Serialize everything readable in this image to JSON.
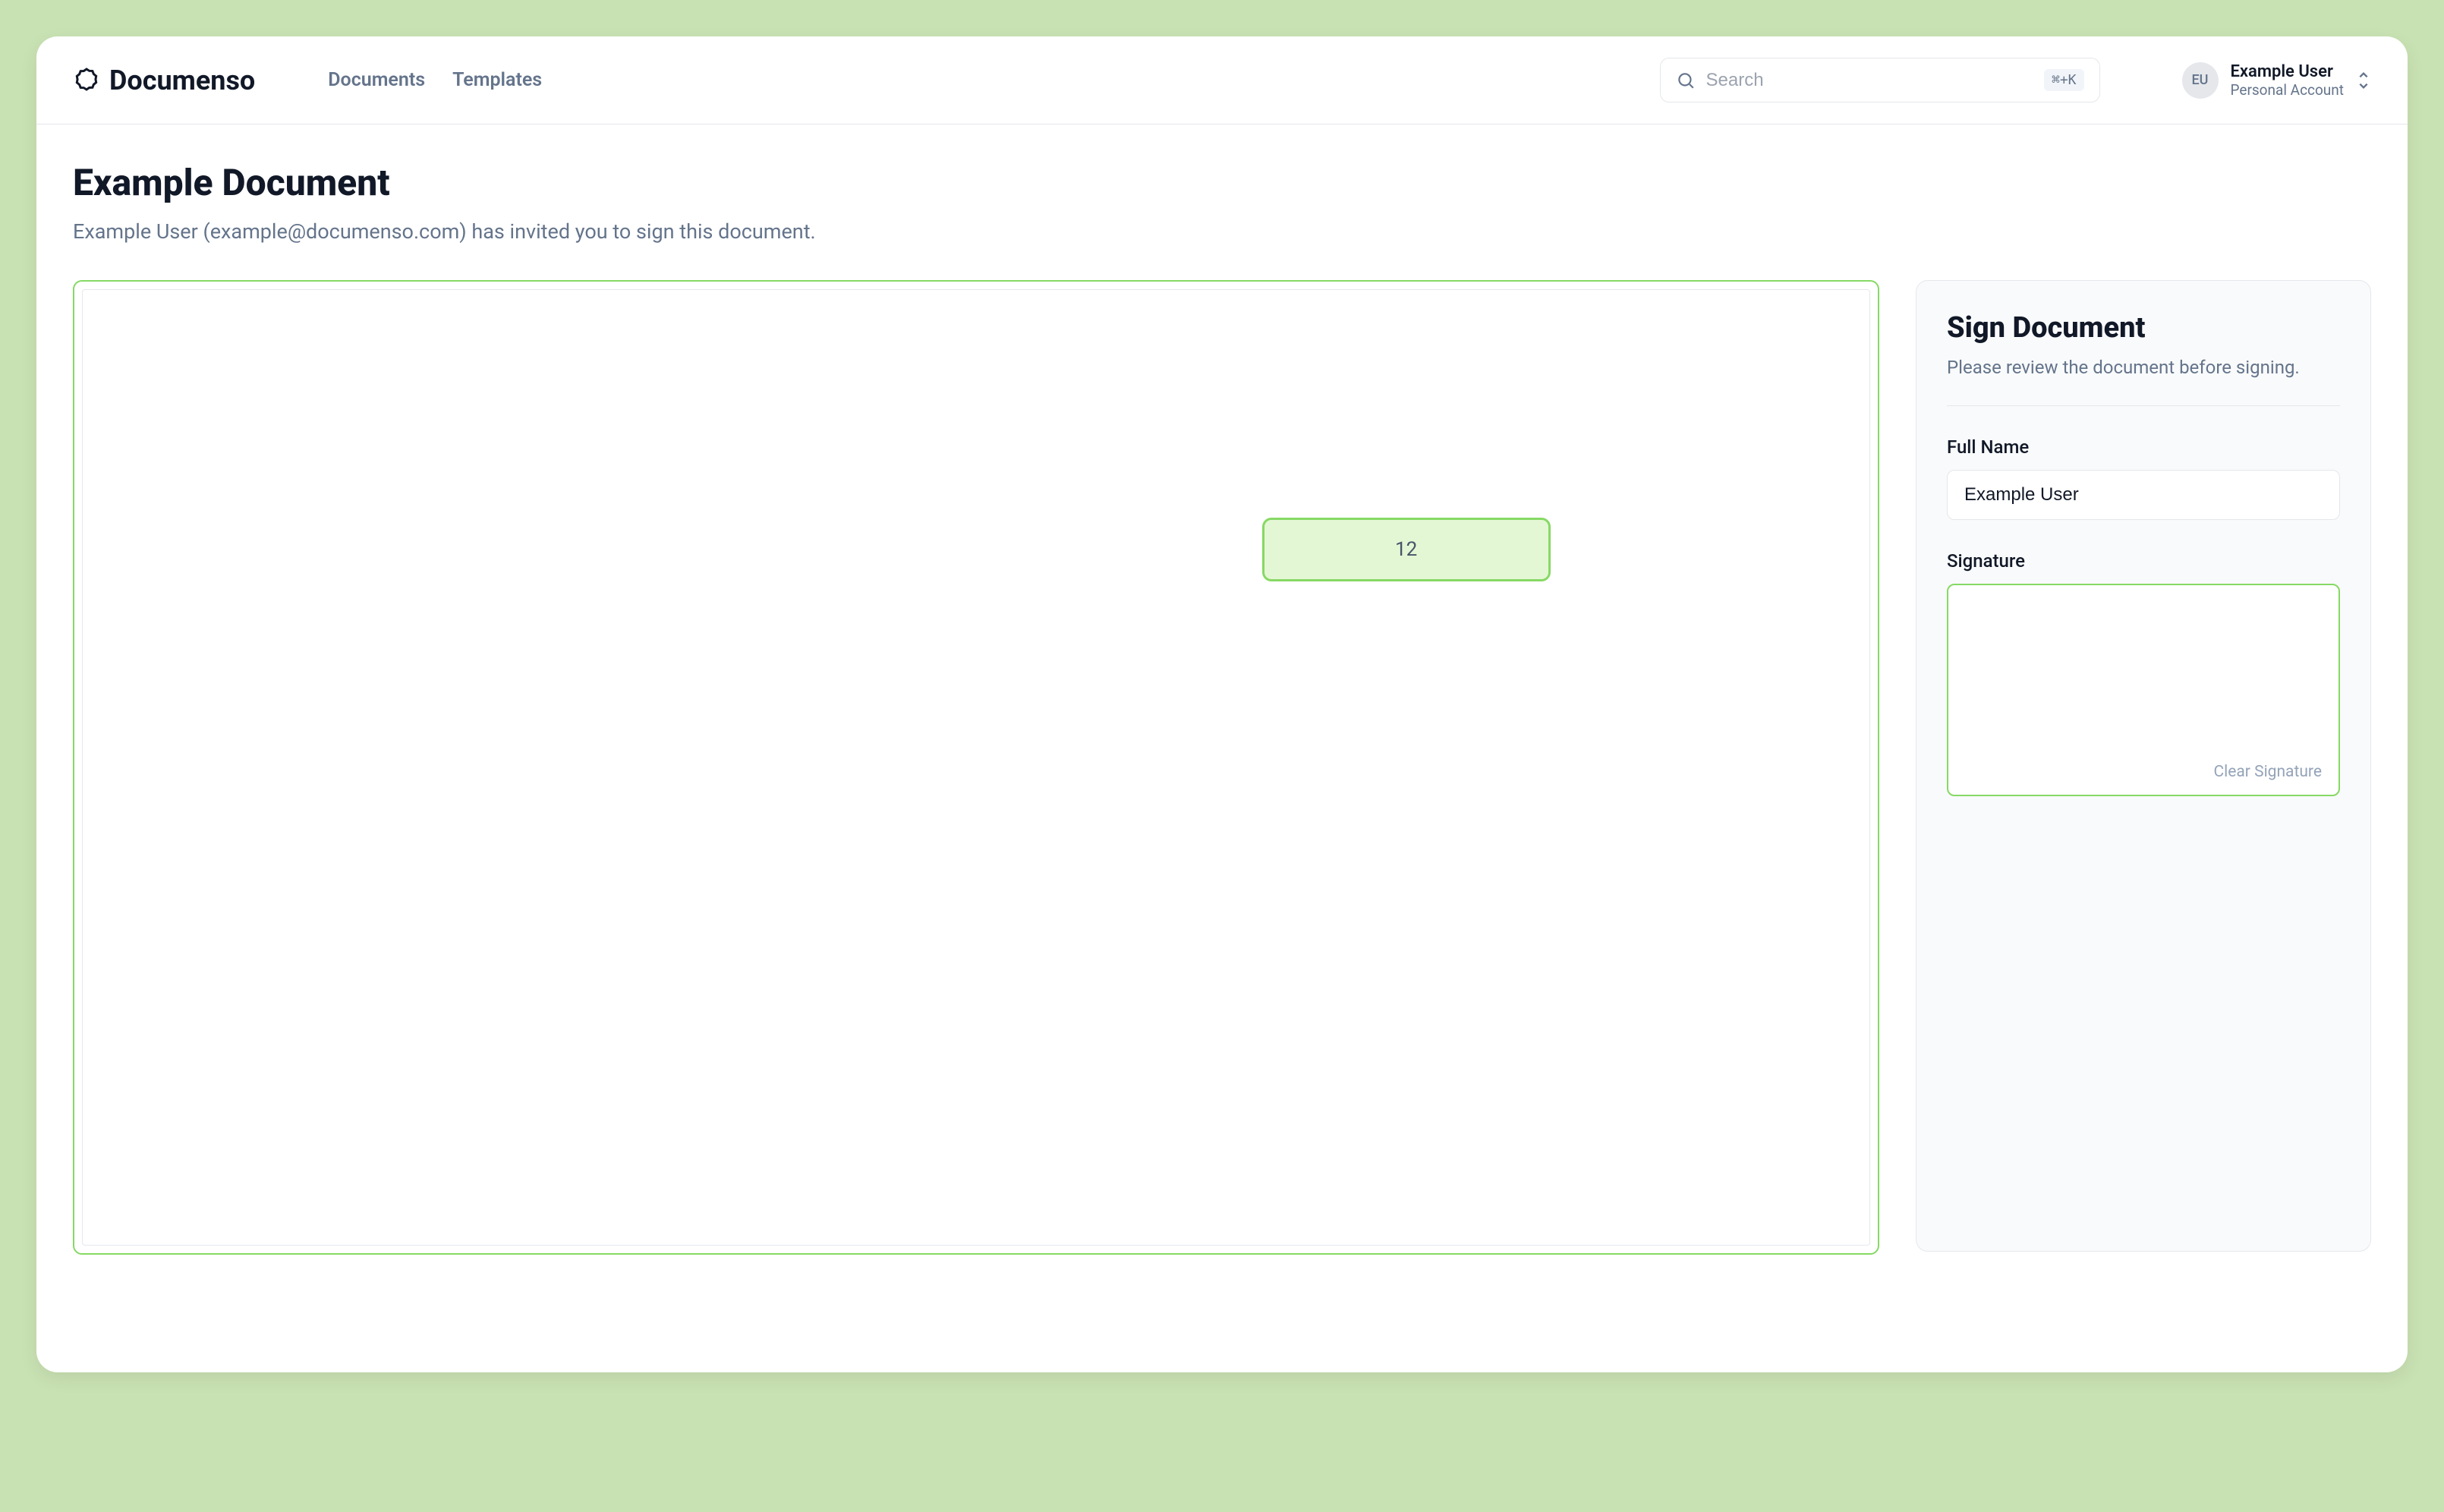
{
  "brand": {
    "name": "Documenso"
  },
  "nav": {
    "documents": "Documents",
    "templates": "Templates"
  },
  "search": {
    "placeholder": "Search",
    "shortcut": "⌘+K"
  },
  "account": {
    "initials": "EU",
    "name": "Example User",
    "sub": "Personal Account"
  },
  "page": {
    "title": "Example Document",
    "subtitle": "Example User (example@documenso.com) has invited you to sign this document."
  },
  "doc": {
    "field_value": "12"
  },
  "panel": {
    "title": "Sign Document",
    "subtitle": "Please review the document before signing.",
    "full_name_label": "Full Name",
    "full_name_value": "Example User",
    "signature_label": "Signature",
    "clear_signature": "Clear Signature"
  }
}
